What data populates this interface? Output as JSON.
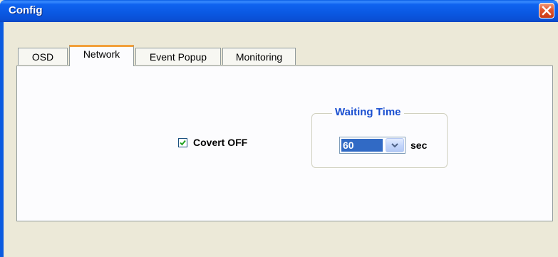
{
  "window": {
    "title": "Config"
  },
  "tabs": [
    {
      "label": "OSD",
      "active": false
    },
    {
      "label": "Network",
      "active": true
    },
    {
      "label": "Event Popup",
      "active": false
    },
    {
      "label": "Monitoring",
      "active": false
    }
  ],
  "network": {
    "covert_label": "Covert OFF",
    "covert_checked": true,
    "waiting_time_title": "Waiting Time",
    "waiting_time_value": "60",
    "waiting_time_unit": "sec"
  },
  "colors": {
    "titlebar": "#0a5be6",
    "selection": "#316ac5",
    "group_title": "#1a4fd0",
    "check": "#21a121"
  },
  "icons": {
    "close": "close-icon",
    "dropdown": "chevron-down-icon",
    "check": "check-icon"
  }
}
